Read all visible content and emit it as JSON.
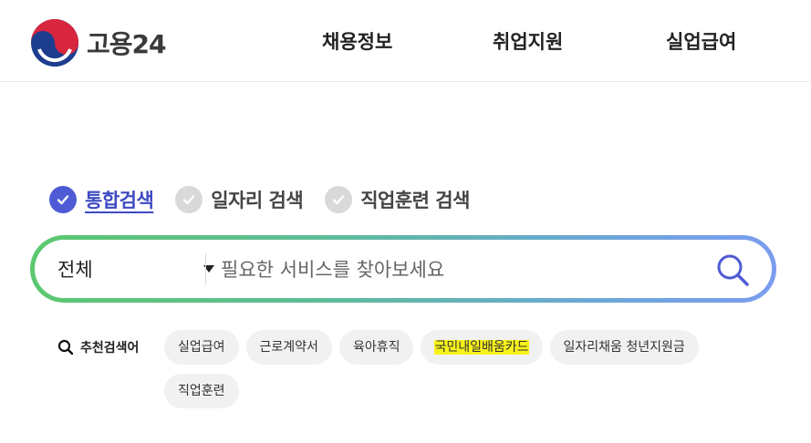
{
  "header": {
    "logo_text": "고용24",
    "nav": [
      "채용정보",
      "취업지원",
      "실업급여"
    ]
  },
  "search": {
    "tabs": [
      {
        "label": "통합검색",
        "active": true
      },
      {
        "label": "일자리 검색",
        "active": false
      },
      {
        "label": "직업훈련 검색",
        "active": false
      }
    ],
    "scope_selected": "전체",
    "placeholder": "필요한 서비스를 찾아보세요",
    "value": ""
  },
  "recommended": {
    "label": "추천검색어",
    "keywords": [
      "실업급여",
      "근로계약서",
      "육아휴직",
      "국민내일배움카드",
      "일자리채움 청년지원금",
      "직업훈련"
    ],
    "highlighted_keyword": "국민내일배움카드"
  },
  "colors": {
    "accent": "#4f5bd5",
    "highlight": "#f7f21a",
    "search_gradient": [
      "#5cc86f",
      "#7c9cf0"
    ]
  },
  "icons": [
    "taegeuk-logo-icon",
    "check-icon",
    "search-icon",
    "caret-down-icon"
  ]
}
